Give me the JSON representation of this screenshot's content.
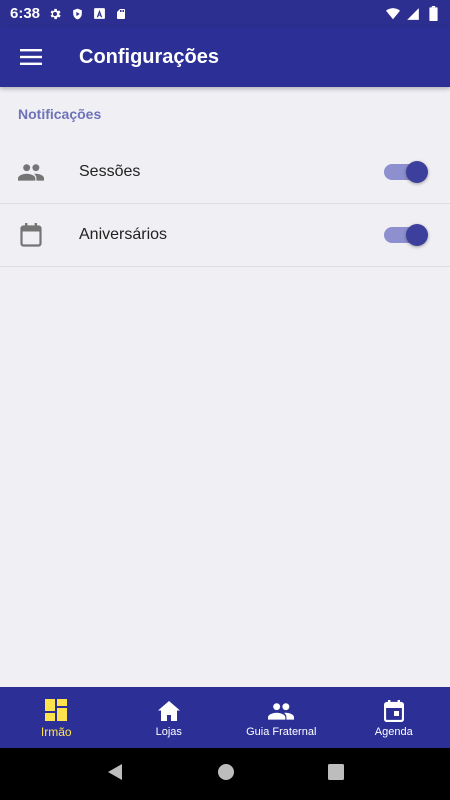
{
  "status_bar": {
    "time": "6:38",
    "icons": [
      "gear-icon",
      "shield-icon",
      "a-icon",
      "sd-card-icon"
    ],
    "right_icons": [
      "wifi-icon",
      "signal-icon",
      "battery-icon"
    ]
  },
  "app_bar": {
    "title": "Configurações",
    "menu_icon": "hamburger-menu-icon"
  },
  "settings": {
    "section_title": "Notificações",
    "items": [
      {
        "label": "Sessões",
        "icon": "group-icon",
        "enabled": true
      },
      {
        "label": "Aniversários",
        "icon": "calendar-icon",
        "enabled": true
      }
    ]
  },
  "bottom_nav": {
    "items": [
      {
        "label": "Irmão",
        "icon": "dashboard-icon",
        "active": true
      },
      {
        "label": "Lojas",
        "icon": "home-icon",
        "active": false
      },
      {
        "label": "Guia Fraternal",
        "icon": "people-icon",
        "active": false
      },
      {
        "label": "Agenda",
        "icon": "event-icon",
        "active": false
      }
    ]
  },
  "colors": {
    "primary": "#2c2f96",
    "section_header": "#6f72b8",
    "toggle_track": "#8d8fcf",
    "toggle_knob": "#3d3f9c",
    "active_nav": "#ffe34d"
  }
}
